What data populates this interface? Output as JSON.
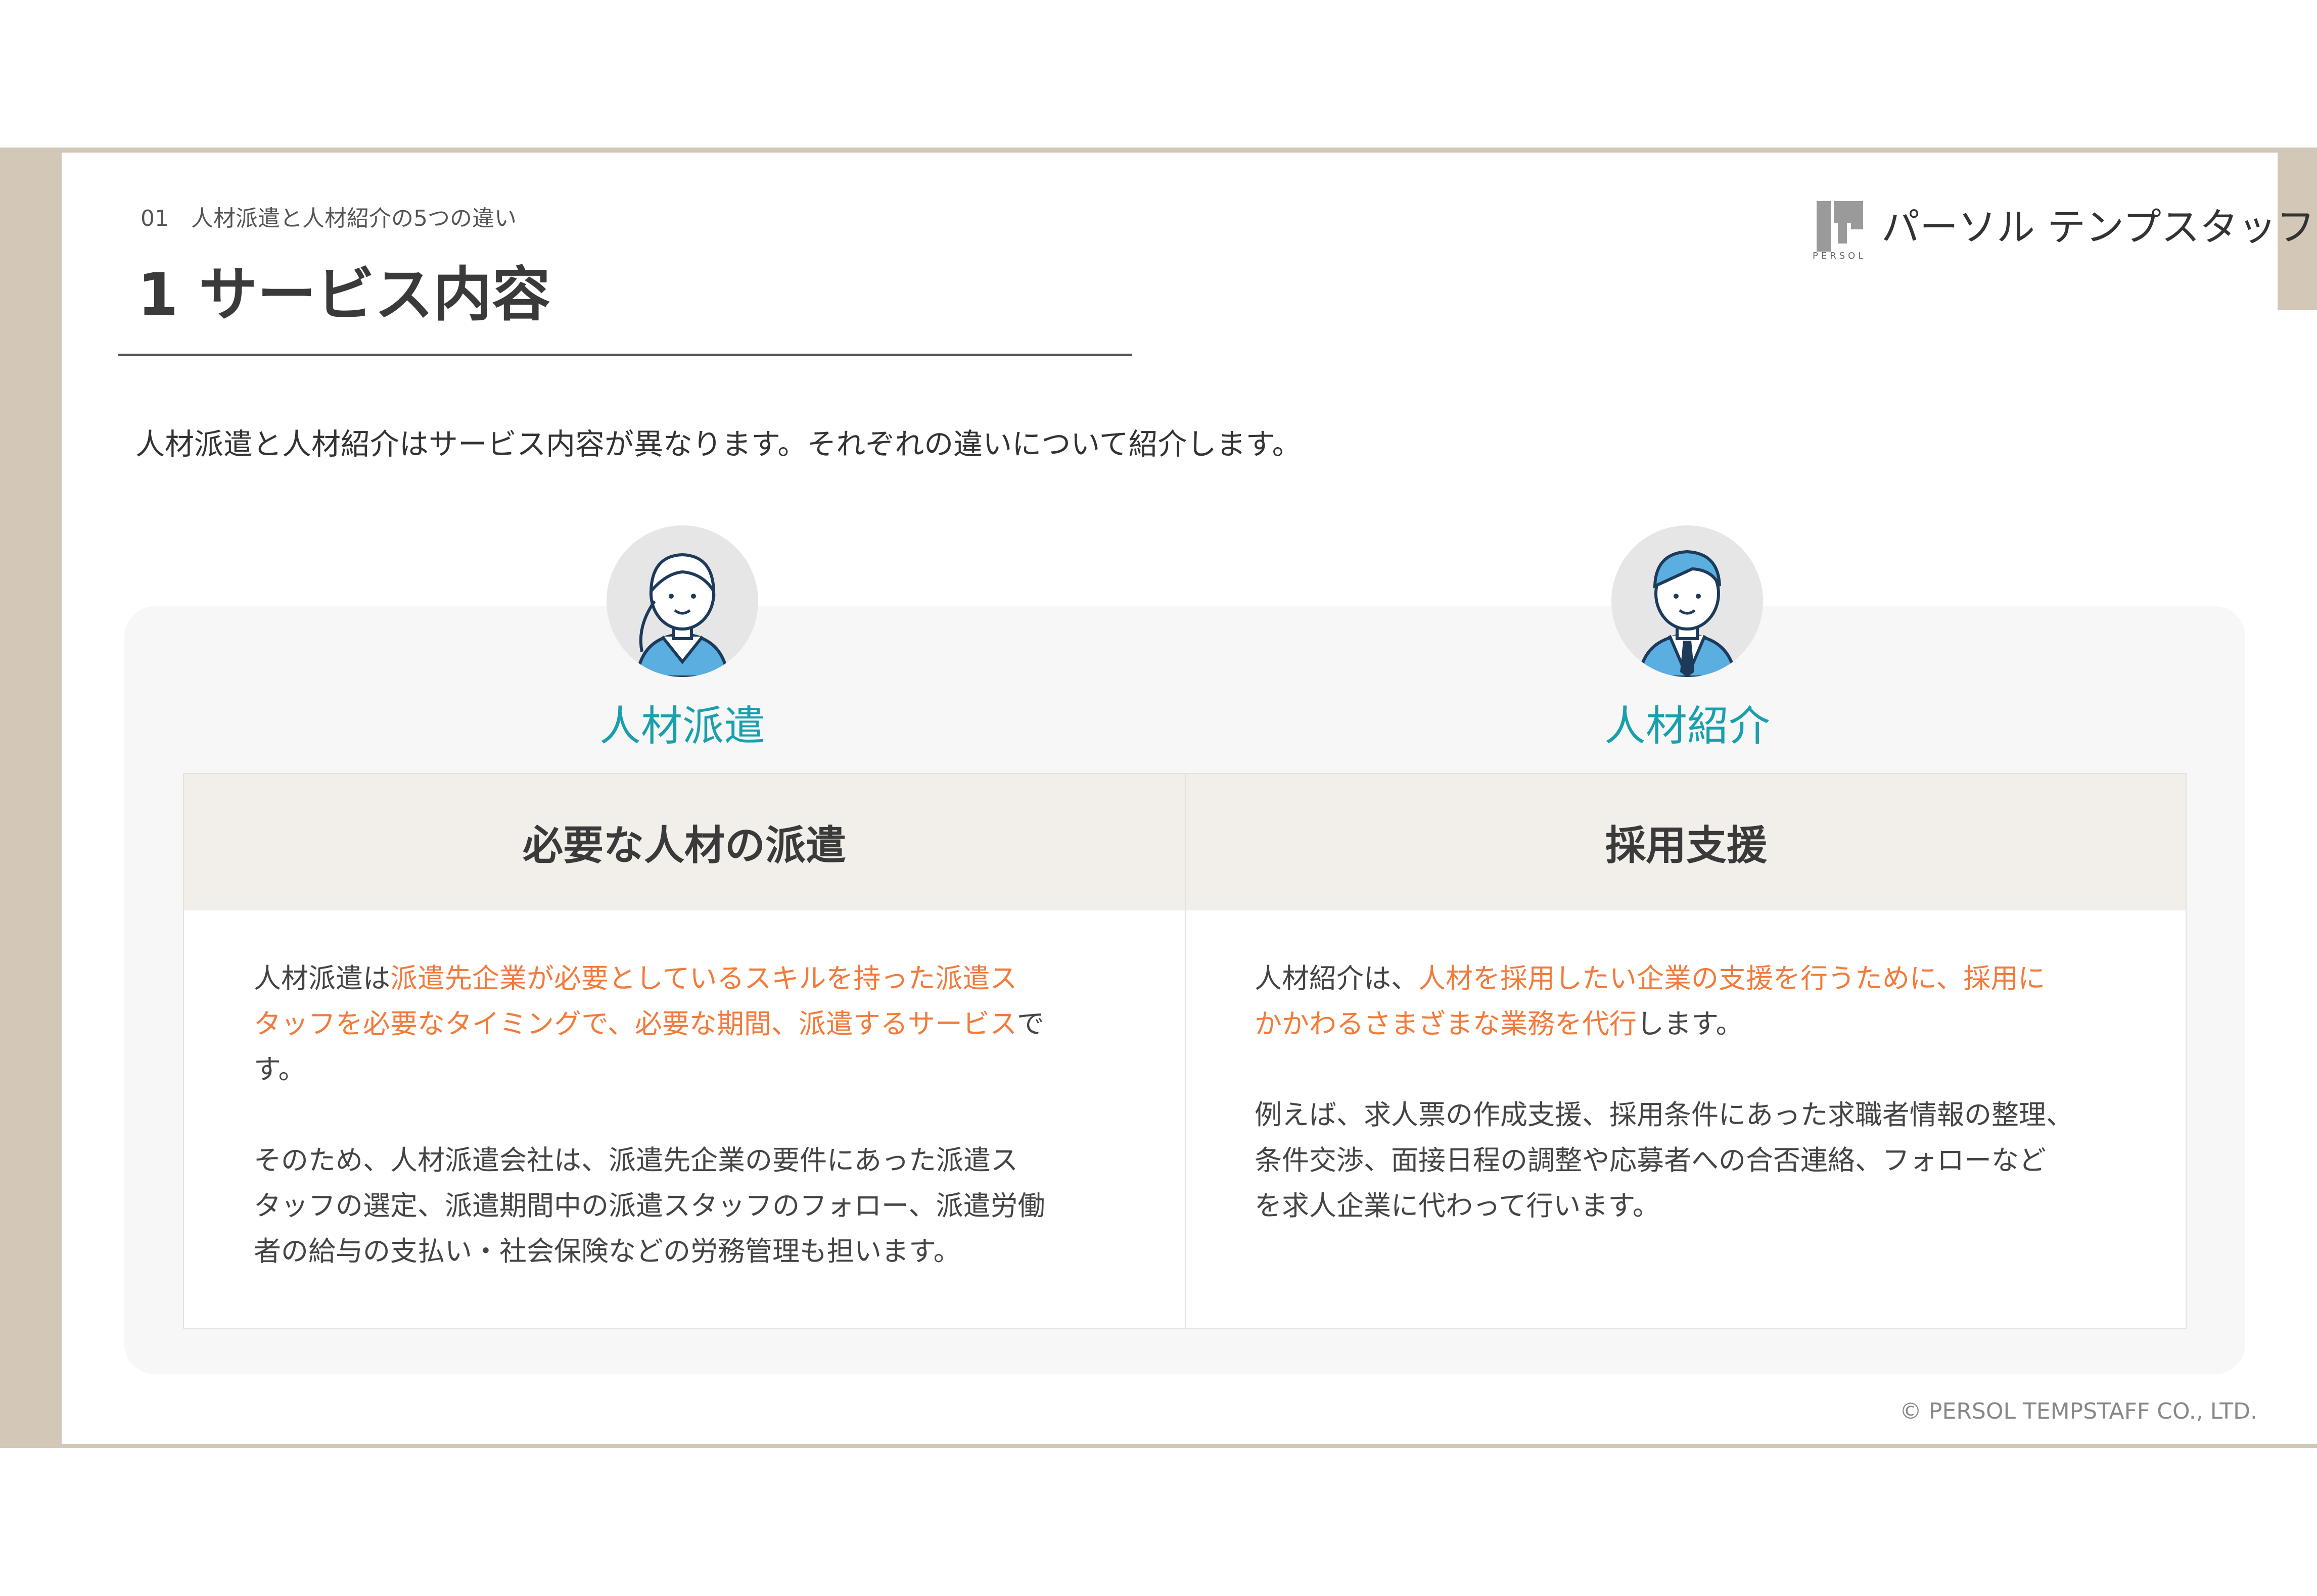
{
  "breadcrumb": {
    "number": "01",
    "text": "人材派遣と人材紹介の5つの違い"
  },
  "title": "1 サービス内容",
  "logo": {
    "icon": "persol-logo-icon",
    "sub": "PERSOL",
    "text": "パーソル テンプスタッフ"
  },
  "intro": "人材派遣と人材紹介はサービス内容が異なります。それぞれの違いについて紹介します。",
  "columns": [
    {
      "avatar_icon": "woman-avatar-icon",
      "label": "人材派遣",
      "header": "必要な人材の派遣",
      "p1": {
        "line1_a": "人材派遣は",
        "line1_b": "派遣先企業が必要としているスキルを持った派遣ス",
        "line2_a": "タッフを必要なタイミングで、必要な期間、派遣するサービス",
        "line2_b": "で",
        "line3": "す。"
      },
      "p2": {
        "line1": "そのため、人材派遣会社は、派遣先企業の要件にあった派遣ス",
        "line2": "タッフの選定、派遣期間中の派遣スタッフのフォロー、派遣労働",
        "line3": "者の給与の支払い・社会保険などの労務管理も担います。"
      }
    },
    {
      "avatar_icon": "man-avatar-icon",
      "label": "人材紹介",
      "header": "採用支援",
      "p1": {
        "line1_a": "人材紹介は、",
        "line1_b": "人材を採用したい企業の支援を行うために、採用に",
        "line2_a": "かかわるさまざまな業務を代行",
        "line2_b": "します。"
      },
      "p2": {
        "line1": "例えば、求人票の作成支援、採用条件にあった求職者情報の整理、",
        "line2": "条件交渉、面接日程の調整や応募者への合否連絡、フォローなど",
        "line3": "を求人企業に代わって行います。"
      }
    }
  ],
  "colors": {
    "frame": "#d3c8b8",
    "accent_teal": "#1a9fae",
    "highlight_orange": "#f27a3a",
    "header_bg": "#f2efea"
  },
  "copyright": "© PERSOL TEMPSTAFF CO., LTD."
}
